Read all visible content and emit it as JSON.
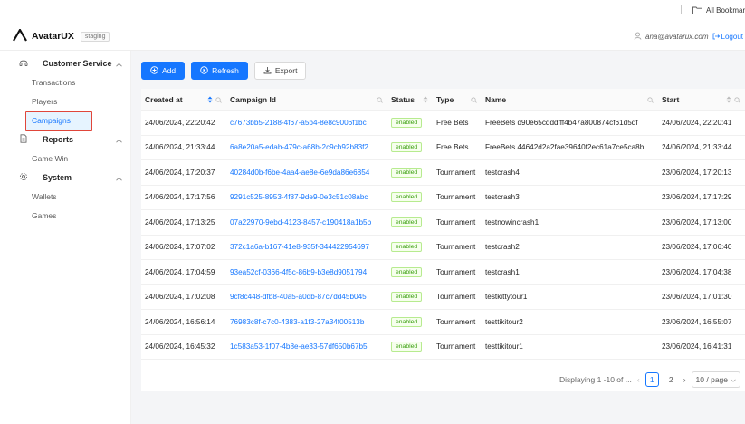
{
  "bookmarks": {
    "label": "All Bookmarks"
  },
  "header": {
    "logo_text": "AvatarUX",
    "env_badge": "staging",
    "user_email": "ana@avatarux.com",
    "logout_label": "Logout"
  },
  "sidebar": {
    "groups": [
      {
        "label": "Customer Service",
        "icon": "headset-icon",
        "items": [
          "Transactions",
          "Players",
          "Campaigns"
        ]
      },
      {
        "label": "Reports",
        "icon": "file-icon",
        "items": [
          "Game Win"
        ]
      },
      {
        "label": "System",
        "icon": "gear-icon",
        "items": [
          "Wallets",
          "Games"
        ]
      }
    ],
    "selected_item": "Campaigns"
  },
  "toolbar": {
    "add_label": "Add",
    "refresh_label": "Refresh",
    "export_label": "Export"
  },
  "table": {
    "columns": [
      "Created at",
      "Campaign Id",
      "Status",
      "Type",
      "Name",
      "Start"
    ],
    "rows": [
      {
        "created": "24/06/2024, 22:20:42",
        "id": "c7673bb5-2188-4f67-a5b4-8e8c9006f1bc",
        "status": "enabled",
        "type": "Free Bets",
        "name": "FreeBets d90e65cdddfff4b47a800874cf61d5df",
        "start": "24/06/2024, 22:20:41"
      },
      {
        "created": "24/06/2024, 21:33:44",
        "id": "6a8e20a5-edab-479c-a68b-2c9cb92b83f2",
        "status": "enabled",
        "type": "Free Bets",
        "name": "FreeBets 44642d2a2fae39640f2ec61a7ce5ca8b",
        "start": "24/06/2024, 21:33:44"
      },
      {
        "created": "24/06/2024, 17:20:37",
        "id": "40284d0b-f6be-4aa4-ae8e-6e9da86e6854",
        "status": "enabled",
        "type": "Tournament",
        "name": "testcrash4",
        "start": "23/06/2024, 17:20:13"
      },
      {
        "created": "24/06/2024, 17:17:56",
        "id": "9291c525-8953-4f87-9de9-0e3c51c08abc",
        "status": "enabled",
        "type": "Tournament",
        "name": "testcrash3",
        "start": "23/06/2024, 17:17:29"
      },
      {
        "created": "24/06/2024, 17:13:25",
        "id": "07a22970-9ebd-4123-8457-c190418a1b5b",
        "status": "enabled",
        "type": "Tournament",
        "name": "testnowincrash1",
        "start": "23/06/2024, 17:13:00"
      },
      {
        "created": "24/06/2024, 17:07:02",
        "id": "372c1a6a-b167-41e8-935f-344422954697",
        "status": "enabled",
        "type": "Tournament",
        "name": "testcrash2",
        "start": "23/06/2024, 17:06:40"
      },
      {
        "created": "24/06/2024, 17:04:59",
        "id": "93ea52cf-0366-4f5c-86b9-b3e8d9051794",
        "status": "enabled",
        "type": "Tournament",
        "name": "testcrash1",
        "start": "23/06/2024, 17:04:38"
      },
      {
        "created": "24/06/2024, 17:02:08",
        "id": "9cf8c448-dfb8-40a5-a0db-87c7dd45b045",
        "status": "enabled",
        "type": "Tournament",
        "name": "testkittytour1",
        "start": "23/06/2024, 17:01:30"
      },
      {
        "created": "24/06/2024, 16:56:14",
        "id": "76983c8f-c7c0-4383-a1f3-27a34f00513b",
        "status": "enabled",
        "type": "Tournament",
        "name": "testtikitour2",
        "start": "23/06/2024, 16:55:07"
      },
      {
        "created": "24/06/2024, 16:45:32",
        "id": "1c583a53-1f07-4b8e-ae33-57df650b67b5",
        "status": "enabled",
        "type": "Tournament",
        "name": "testtikitour1",
        "start": "23/06/2024, 16:41:31"
      }
    ]
  },
  "pagination": {
    "info": "Displaying 1 -10 of ...",
    "current_page": "1",
    "next_page": "2",
    "page_size": "10 / page"
  },
  "colors": {
    "primary": "#1677ff",
    "enabled_tag": "#389e0d",
    "highlight_box": "#e0463a",
    "content_bg": "#f4f5f7"
  }
}
